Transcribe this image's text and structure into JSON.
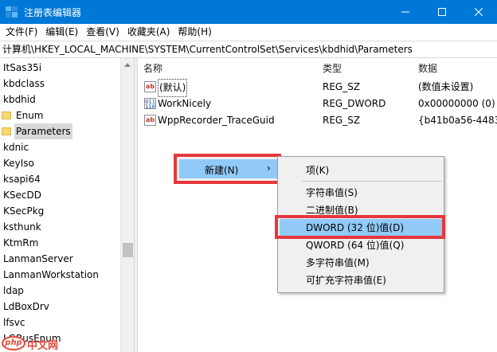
{
  "window": {
    "title": "注册表编辑器"
  },
  "menubar": [
    {
      "label": "文件(F)"
    },
    {
      "label": "编辑(E)"
    },
    {
      "label": "查看(V)"
    },
    {
      "label": "收藏夹(A)"
    },
    {
      "label": "帮助(H)"
    }
  ],
  "address": "计算机\\HKEY_LOCAL_MACHINE\\SYSTEM\\CurrentControlSet\\Services\\kbdhid\\Parameters",
  "tree": {
    "items": [
      {
        "label": "ItSas35i"
      },
      {
        "label": "kbdclass"
      },
      {
        "label": "kbdhid"
      },
      {
        "label": "Enum"
      },
      {
        "label": "Parameters"
      },
      {
        "label": "kdnic"
      },
      {
        "label": "KeyIso"
      },
      {
        "label": "ksapi64"
      },
      {
        "label": "KSecDD"
      },
      {
        "label": "KSecPkg"
      },
      {
        "label": "ksthunk"
      },
      {
        "label": "KtmRm"
      },
      {
        "label": "LanmanServer"
      },
      {
        "label": "LanmanWorkstation"
      },
      {
        "label": "ldap"
      },
      {
        "label": "LdBoxDrv"
      },
      {
        "label": "lfsvc"
      },
      {
        "label": "LGBusEnum"
      }
    ]
  },
  "list": {
    "columns": {
      "name": "名称",
      "type": "类型",
      "data": "数据"
    },
    "rows": [
      {
        "name": "(默认)",
        "type": "REG_SZ",
        "data": "(数值未设置)",
        "icon": "string-value-icon"
      },
      {
        "name": "WorkNicely",
        "type": "REG_DWORD",
        "data": "0x00000000 (0)",
        "icon": "binary-value-icon"
      },
      {
        "name": "WppRecorder_TraceGuid",
        "type": "REG_SZ",
        "data": "{b41b0a56-4483",
        "icon": "string-value-icon"
      }
    ]
  },
  "context_menu": {
    "new_label": "新建(N)",
    "chevron": "›",
    "submenu": [
      {
        "label": "项(K)"
      },
      {
        "label": "字符串值(S)"
      },
      {
        "label": "二进制值(B)"
      },
      {
        "label": "DWORD (32 位)值(D)"
      },
      {
        "label": "QWORD (64 位)值(Q)"
      },
      {
        "label": "多字符串值(M)"
      },
      {
        "label": "可扩充字符串值(E)"
      }
    ]
  },
  "watermark": {
    "logo": "php",
    "text": "中文网"
  },
  "colors": {
    "titlebar": "#0078d7",
    "highlight": "#91c9f7",
    "annotation_red": "#e6373c"
  }
}
